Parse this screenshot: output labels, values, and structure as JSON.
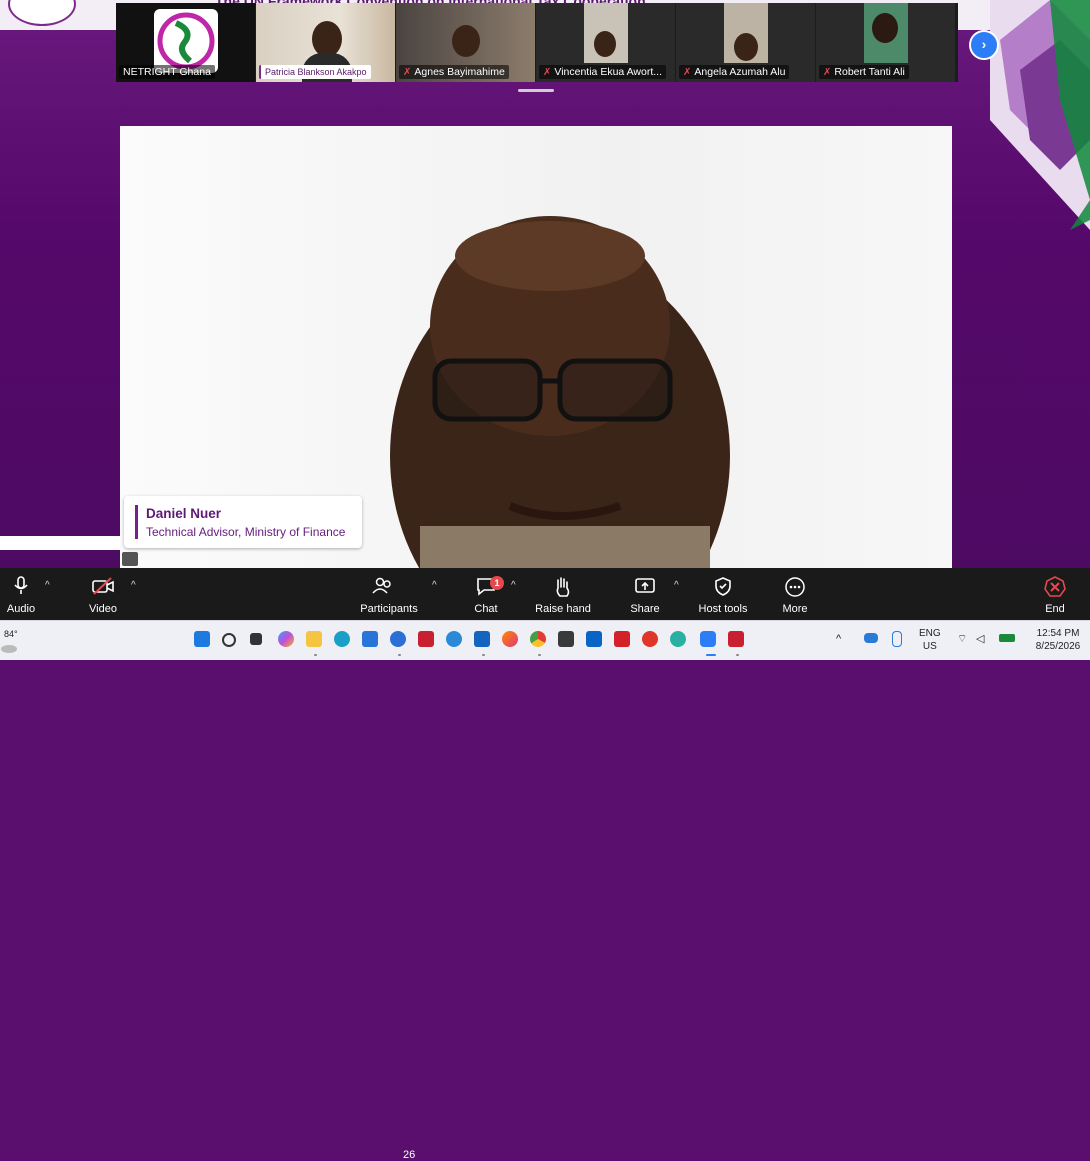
{
  "banner": {
    "text": "The UN Framework Convention on International Tax Cooperation"
  },
  "participants_strip": [
    {
      "name": "NETRIGHT Ghana",
      "muted": false
    },
    {
      "name": "Patricia Blankson Akakpo",
      "muted": false
    },
    {
      "name": "Agnes Bayimahime",
      "muted": true
    },
    {
      "name": "Vincentia Ekua Awort...",
      "muted": true
    },
    {
      "name": "Angela Azumah Alu",
      "muted": true
    },
    {
      "name": "Robert Tanti Ali",
      "muted": true
    }
  ],
  "speaker": {
    "name": "Daniel Nuer",
    "title": "Technical Advisor, Ministry of Finance"
  },
  "toolbar": {
    "audio_label": "Audio",
    "video_label": "Video",
    "participants_label": "Participants",
    "participants_count": "26",
    "chat_label": "Chat",
    "chat_badge": "1",
    "raise_hand_label": "Raise hand",
    "share_label": "Share",
    "host_tools_label": "Host tools",
    "more_label": "More",
    "end_label": "End"
  },
  "taskbar": {
    "weather": "84°",
    "language_line1": "ENG",
    "language_line2": "US",
    "time": "12:54 PM",
    "date": "8/25/2026",
    "pinned_icons": [
      "windows-start-icon",
      "search-icon",
      "task-view-icon",
      "copilot-icon",
      "file-explorer-icon",
      "edge-icon",
      "store-icon",
      "help-icon",
      "mcafee-icon",
      "app-icon",
      "outlook-icon",
      "firefox-icon",
      "chrome-icon",
      "sticky-icon",
      "outlook-new-icon",
      "acrobat-icon",
      "cc-icon",
      "edge-beta-icon",
      "zoom-icon",
      "mcafee-shield-icon"
    ]
  },
  "colors": {
    "brand_purple": "#5a0f6e",
    "accent_blue": "#2d7df6",
    "end_red": "#e5484d"
  }
}
